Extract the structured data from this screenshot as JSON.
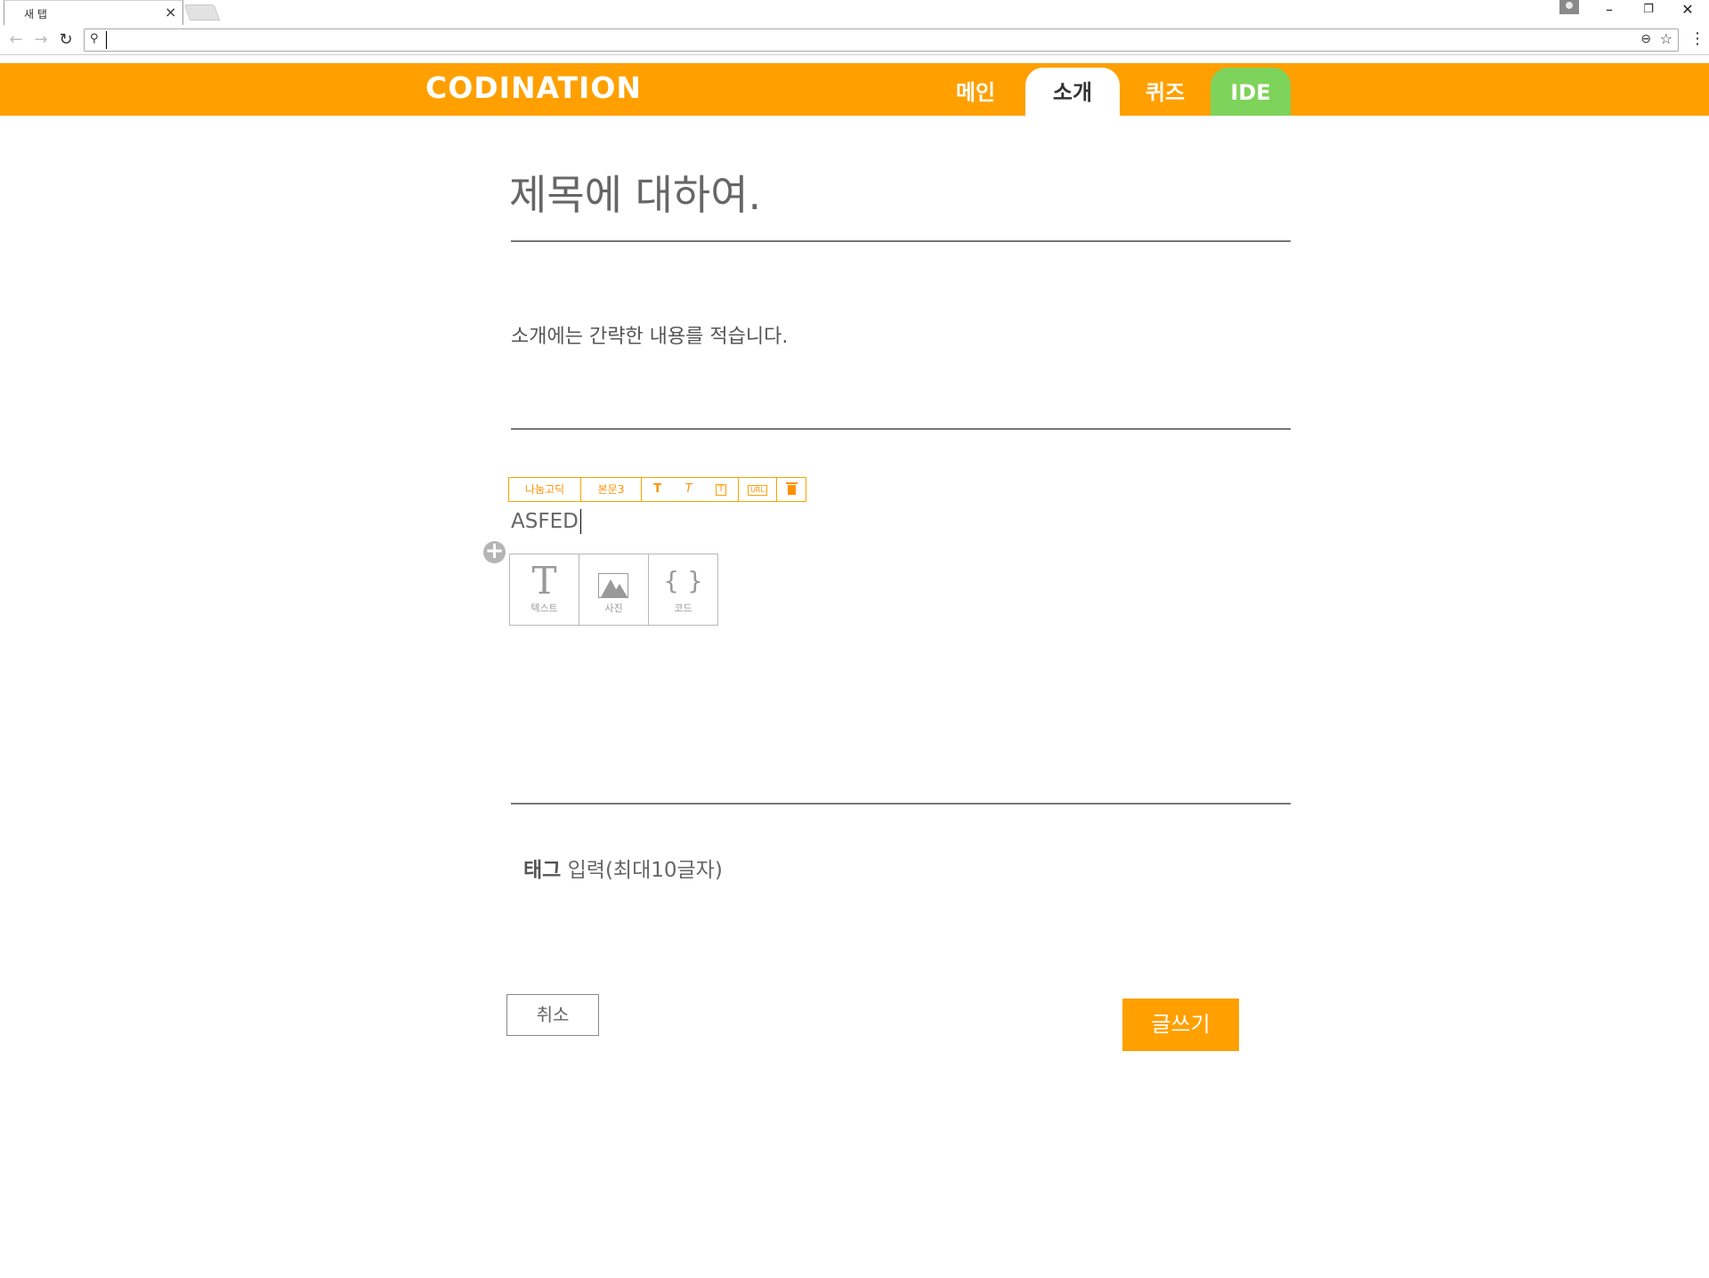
{
  "browser": {
    "tab_title": "새 탭",
    "tab_close": "×",
    "address_value": "",
    "back": "←",
    "forward": "→",
    "reload": "↻",
    "search_glyph": "⚲",
    "zoom_glyph": "⊖",
    "star_glyph": "☆",
    "menu_glyph": "⋮",
    "minimize": "–",
    "restore": "❐",
    "close": "✕"
  },
  "site": {
    "logo": "CODINATION",
    "nav": {
      "main": "메인",
      "intro": "소개",
      "quiz": "퀴즈",
      "ide": "IDE"
    },
    "colors": {
      "brand": "#ffa000",
      "ide": "#7ed35a"
    }
  },
  "editor": {
    "title": "제목에 대하여.",
    "intro": "소개에는 간략한 내용를 적습니다.",
    "toolbar": {
      "font": "나눔고딕",
      "size": "본문3",
      "bold": "T",
      "italic": "T",
      "textbox": "T",
      "url": "URL"
    },
    "body_text": "ASFED",
    "add_glyph": "+",
    "insert": {
      "text_glyph": "T",
      "text_label": "텍스트",
      "photo_label": "사진",
      "code_glyph": "{ }",
      "code_label": "코드"
    },
    "tag_bold": "태그",
    "tag_rest": " 입력(최대10글자)",
    "cancel": "취소",
    "write": "글쓰기"
  }
}
